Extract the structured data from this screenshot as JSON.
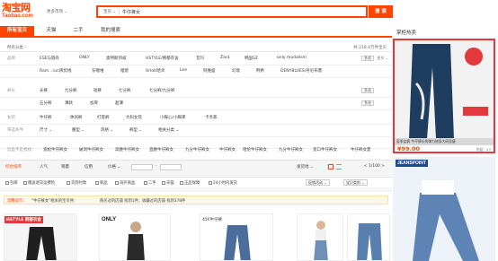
{
  "header": {
    "logo_cn": "淘宝网",
    "logo_en": "Taobao.com",
    "market": "更多市场 ⌄",
    "search_category": "宝贝 ⌄",
    "search_value": "牛仔裤女",
    "search_button": "搜 索"
  },
  "tabs": [
    "所有宝贝",
    "天猫",
    "二手",
    "我的搜索"
  ],
  "side_title": "掌柜热卖",
  "filter": {
    "crumb": "所有分类 ›",
    "count": "共 218.4万件宝贝",
    "rows": [
      {
        "label": "品牌",
        "values": [
          "ESE与圆舟",
          "ONLY",
          "奥特斯邦威",
          "HSTYLE/韩都衣舍",
          "音玛",
          "Zara",
          "韩国SZ",
          "only modalism"
        ]
      },
      {
        "label": "",
        "values": [
          "Ram...run牌剪线",
          "东喔堆",
          "哩佬",
          "Urlot/哈幸",
          "Lee",
          "阿维盛",
          "幻境",
          "荆希",
          "DENYBLUES/丹尼布鲁"
        ]
      },
      {
        "label": "裤长",
        "values": [
          "长裤",
          "九分裤",
          "短裤",
          "七分裤",
          "七分裤/九分裤"
        ]
      },
      {
        "label": "",
        "values": [
          "五分裤",
          "薄款",
          "加厚",
          "超薄"
        ]
      },
      {
        "label": "女装",
        "values": [
          "牛仔裤",
          "休闲裤",
          "打底裤",
          "大码女装",
          "小脚心/小脚库",
          "卡务家"
        ]
      },
      {
        "label": "筛选条件",
        "values": [
          "尺寸 ⌄",
          "腰型 ⌄",
          "风格 ⌄",
          "裤型 ⌄",
          "相关分类 ⌄"
        ]
      }
    ],
    "more": "多选",
    "more_toggle": "更多 ⌄",
    "related_label": "您是不是想找：",
    "related": [
      "宽松牛仔裤女",
      "破洞牛仔裤女",
      "高腰牛仔裤女",
      "直腰牛仔裤女",
      "九分牛仔裤女",
      "牛仔裤女",
      "哈伦牛仔裤女",
      "九分牛仔裤女",
      "宽口牛仔裤女",
      "牛仔裤女夏"
    ]
  },
  "sortbar": {
    "sorts": [
      "综合排序",
      "人气",
      "销量",
      "信用",
      "价格 ⌄"
    ],
    "price_sep": "-",
    "pager": "< 1/100 >",
    "ship": "发货地 ⌄",
    "checks": [
      "包邮",
      "赠送退货运费险",
      "货到付款",
      "新品",
      "海外商品",
      "二手",
      "天猫",
      "正品保障",
      "24小时内发货"
    ],
    "pills": [
      "促销活动 ⌄",
      "宝贝类别 ⌄"
    ]
  },
  "notice": {
    "prefix": "温馨提示：",
    "text1": "\"牛仔裤女\"相关的宝贝共：",
    "text2": "购买过的店铺 找到1件；收藏过的店铺 找到378件"
  },
  "ad": {
    "caption": "夏季女裤 牛仔裤长的弹力修身大码显瘦",
    "price": "¥99.00",
    "sales": "销量：49"
  },
  "ad2": {
    "brand": "JEANSPOINT"
  },
  "products": [
    {
      "brand": "HSTYLE 韩都衣舍"
    },
    {
      "brand": "ONLY"
    },
    {
      "brand": "45€牛仔裤"
    },
    {
      "brand": ""
    },
    {
      "brand": ""
    }
  ],
  "colors": {
    "accent": "#ff4400",
    "ad_border": "#e4393c"
  }
}
